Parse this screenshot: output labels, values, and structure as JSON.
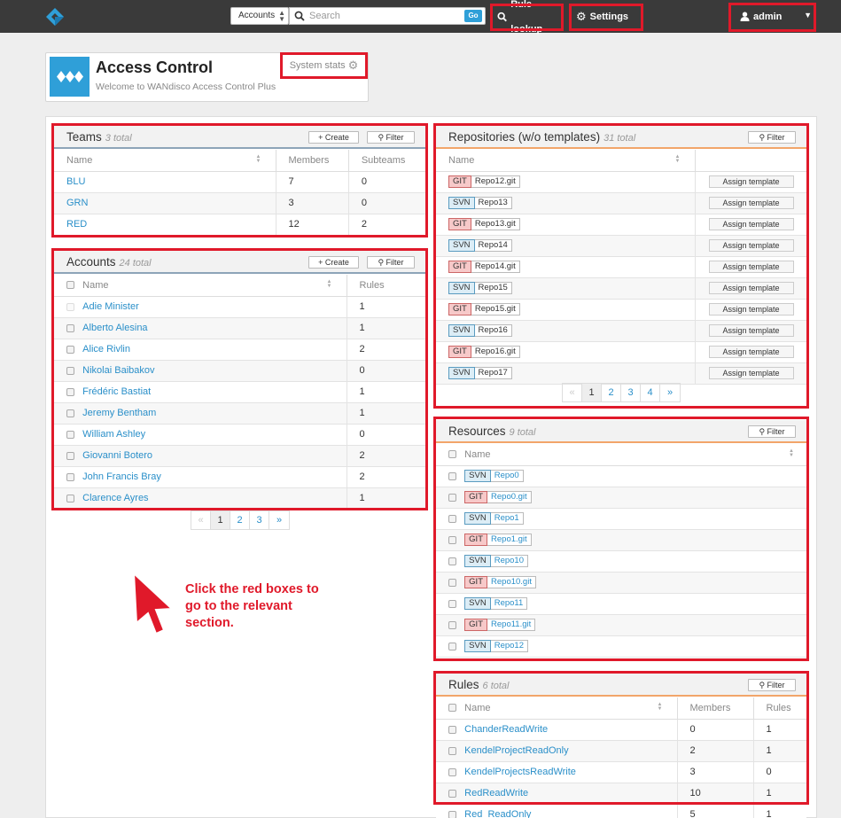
{
  "topbar": {
    "search_scope": "Accounts",
    "search_placeholder": "Search",
    "go_label": "Go",
    "rule_lookup_label": "Rule lookup",
    "settings_label": "Settings",
    "user_label": "admin"
  },
  "header": {
    "title": "Access Control",
    "subtitle": "Welcome to WANdisco Access Control Plus",
    "system_stats_label": "System stats"
  },
  "teams": {
    "title": "Teams",
    "count": "3 total",
    "create_label": "+ Create",
    "filter_label": "Filter",
    "columns": [
      "Name",
      "Members",
      "Subteams"
    ],
    "rows": [
      {
        "name": "BLU",
        "members": "7",
        "subteams": "0"
      },
      {
        "name": "GRN",
        "members": "3",
        "subteams": "0"
      },
      {
        "name": "RED",
        "members": "12",
        "subteams": "2"
      }
    ]
  },
  "accounts": {
    "title": "Accounts",
    "count": "24 total",
    "create_label": "+ Create",
    "filter_label": "Filter",
    "columns": [
      "Name",
      "Rules"
    ],
    "rows": [
      {
        "name": "Adie Minister",
        "rules": "1"
      },
      {
        "name": "Alberto Alesina",
        "rules": "1"
      },
      {
        "name": "Alice Rivlin",
        "rules": "2"
      },
      {
        "name": "Nikolai Baibakov",
        "rules": "0"
      },
      {
        "name": "Frédéric Bastiat",
        "rules": "1"
      },
      {
        "name": "Jeremy Bentham",
        "rules": "1"
      },
      {
        "name": "William Ashley",
        "rules": "0"
      },
      {
        "name": "Giovanni Botero",
        "rules": "2"
      },
      {
        "name": "John Francis Bray",
        "rules": "2"
      },
      {
        "name": "Clarence Ayres",
        "rules": "1"
      }
    ],
    "pager": [
      "«",
      "1",
      "2",
      "3",
      "»"
    ]
  },
  "repositories": {
    "title": "Repositories (w/o templates)",
    "count": "31 total",
    "filter_label": "Filter",
    "columns": [
      "Name"
    ],
    "assign_label": "Assign template",
    "rows": [
      {
        "type": "GIT",
        "name": "Repo12.git"
      },
      {
        "type": "SVN",
        "name": "Repo13"
      },
      {
        "type": "GIT",
        "name": "Repo13.git"
      },
      {
        "type": "SVN",
        "name": "Repo14"
      },
      {
        "type": "GIT",
        "name": "Repo14.git"
      },
      {
        "type": "SVN",
        "name": "Repo15"
      },
      {
        "type": "GIT",
        "name": "Repo15.git"
      },
      {
        "type": "SVN",
        "name": "Repo16"
      },
      {
        "type": "GIT",
        "name": "Repo16.git"
      },
      {
        "type": "SVN",
        "name": "Repo17"
      }
    ],
    "pager": [
      "«",
      "1",
      "2",
      "3",
      "4",
      "»"
    ]
  },
  "resources": {
    "title": "Resources",
    "count": "9 total",
    "filter_label": "Filter",
    "columns": [
      "Name"
    ],
    "rows": [
      {
        "type": "SVN",
        "name": "Repo0"
      },
      {
        "type": "GIT",
        "name": "Repo0.git"
      },
      {
        "type": "SVN",
        "name": "Repo1"
      },
      {
        "type": "GIT",
        "name": "Repo1.git"
      },
      {
        "type": "SVN",
        "name": "Repo10"
      },
      {
        "type": "GIT",
        "name": "Repo10.git"
      },
      {
        "type": "SVN",
        "name": "Repo11"
      },
      {
        "type": "GIT",
        "name": "Repo11.git"
      },
      {
        "type": "SVN",
        "name": "Repo12"
      }
    ]
  },
  "rules": {
    "title": "Rules",
    "count": "6 total",
    "filter_label": "Filter",
    "columns": [
      "Name",
      "Members",
      "Rules"
    ],
    "rows": [
      {
        "name": "ChanderReadWrite",
        "members": "0",
        "rules": "1"
      },
      {
        "name": "KendelProjectReadOnly",
        "members": "2",
        "rules": "1"
      },
      {
        "name": "KendelProjectsReadWrite",
        "members": "3",
        "rules": "0"
      },
      {
        "name": "RedReadWrite",
        "members": "10",
        "rules": "1"
      },
      {
        "name": "Red_ReadOnly",
        "members": "5",
        "rules": "1"
      }
    ]
  },
  "annotation": "Click the red boxes to go to the relevant section.",
  "colors": {
    "highlight": "#e0192a",
    "brand": "#2f9fd8",
    "topbar": "#3a3a3a",
    "link": "#2a8fc9"
  }
}
